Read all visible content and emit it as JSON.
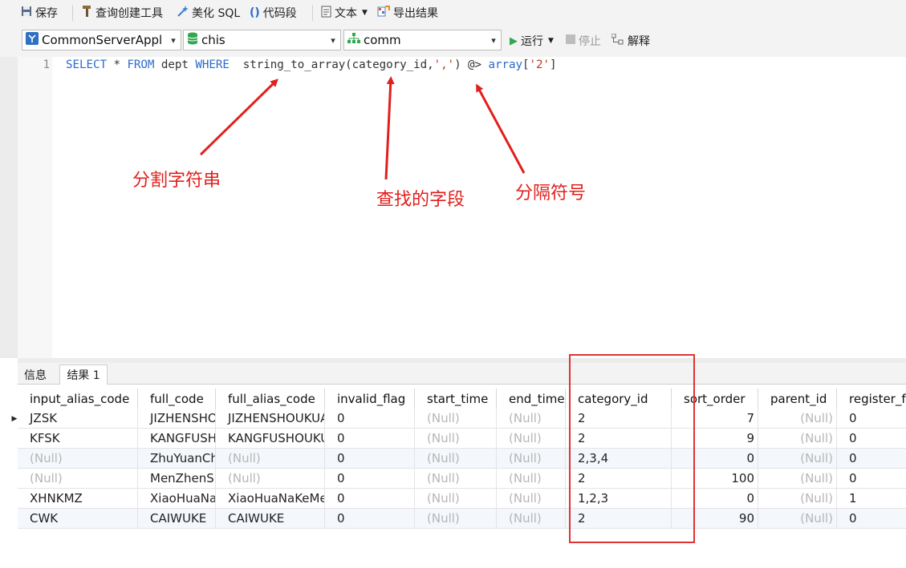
{
  "toolbar": {
    "save": "保存",
    "query_builder": "查询创建工具",
    "beautify": "美化 SQL",
    "snippet": "代码段",
    "text": "文本",
    "export": "导出结果",
    "run": "运行",
    "stop": "停止",
    "explain": "解释"
  },
  "selectors": {
    "connection": "CommonServerAppl",
    "database": "chis",
    "schema": "comm"
  },
  "editor": {
    "line_number": "1",
    "tokens": {
      "select": "SELECT",
      "star": " * ",
      "from": "FROM",
      "table": " dept ",
      "where": "WHERE",
      "func": "  string_to_array(category_id,",
      "sep": "','",
      "rest": ") @> ",
      "array": "array",
      "lb": "[",
      "val": "'2'",
      "rb": "]"
    }
  },
  "annotations": {
    "split": "分割字符串",
    "field": "查找的字段",
    "separator": "分隔符号"
  },
  "result_tabs": [
    "信息",
    "结果 1"
  ],
  "grid": {
    "columns": [
      "input_alias_code",
      "full_code",
      "full_alias_code",
      "invalid_flag",
      "start_time",
      "end_time",
      "category_id",
      "sort_order",
      "parent_id",
      "register_f"
    ],
    "rows": [
      [
        "JZSK",
        "JIZHENSHOU",
        "JIZHENSHOUKUAN",
        "0",
        "(Null)",
        "(Null)",
        "2",
        "7",
        "(Null)",
        "0"
      ],
      [
        "KFSK",
        "KANGFUSHO",
        "KANGFUSHOUKUAN",
        "0",
        "(Null)",
        "(Null)",
        "2",
        "9",
        "(Null)",
        "0"
      ],
      [
        "(Null)",
        "ZhuYuanChu",
        "(Null)",
        "0",
        "(Null)",
        "(Null)",
        "2,3,4",
        "0",
        "(Null)",
        "0"
      ],
      [
        "(Null)",
        "MenZhenSho",
        "(Null)",
        "0",
        "(Null)",
        "(Null)",
        "2",
        "100",
        "(Null)",
        "0"
      ],
      [
        "XHNKMZ",
        "XiaoHuaNaKe",
        "XiaoHuaNaKeMenZ",
        "0",
        "(Null)",
        "(Null)",
        "1,2,3",
        "0",
        "(Null)",
        "1"
      ],
      [
        "CWK",
        "CAIWUKE",
        "CAIWUKE",
        "0",
        "(Null)",
        "(Null)",
        "2",
        "90",
        "(Null)",
        "0"
      ]
    ]
  }
}
